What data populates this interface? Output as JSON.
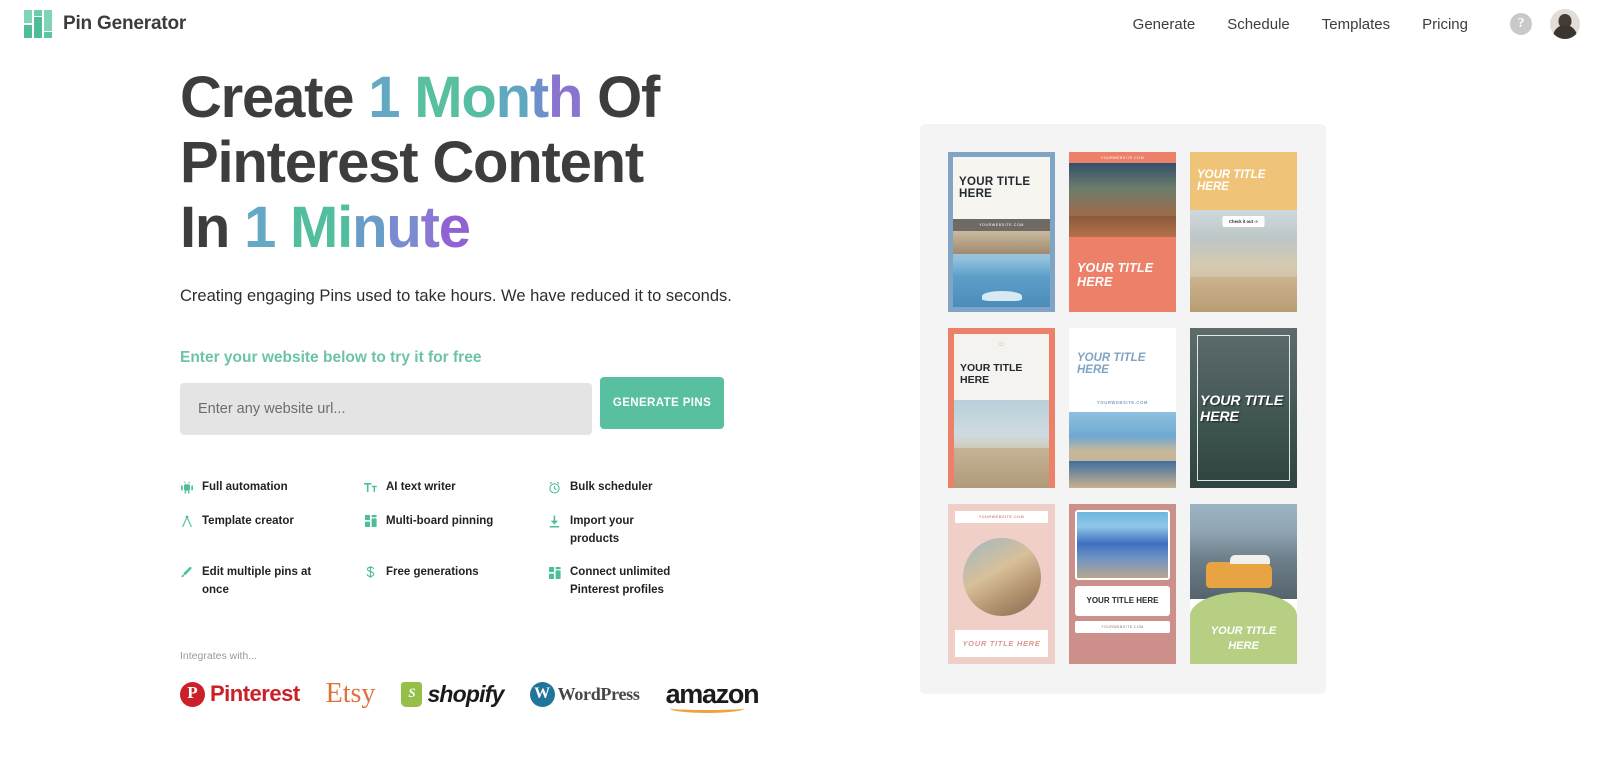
{
  "header": {
    "brand_name": "Pin Generator",
    "logo_icon": "grid-logo-icon",
    "nav": [
      {
        "label": "Generate"
      },
      {
        "label": "Schedule"
      },
      {
        "label": "Templates"
      },
      {
        "label": "Pricing"
      }
    ],
    "help_icon": "question-mark-icon",
    "help_glyph": "?",
    "avatar_icon": "user-avatar"
  },
  "hero": {
    "headline_segments": [
      {
        "text": "Create ",
        "color": "#3d3d3d"
      },
      {
        "text": "1",
        "color": "#64a9c4"
      },
      {
        "text": " ",
        "color": "#3d3d3d"
      },
      {
        "text": "M",
        "color": "#58bfa0"
      },
      {
        "text": "o",
        "color": "#56bda4"
      },
      {
        "text": "n",
        "color": "#5fa8c0"
      },
      {
        "text": "t",
        "color": "#6f8fcc"
      },
      {
        "text": "h",
        "color": "#8a74cf"
      },
      {
        "text": " Of Pinterest Content In ",
        "color": "#3d3d3d"
      },
      {
        "text": "1",
        "color": "#64a9c4"
      },
      {
        "text": " ",
        "color": "#3d3d3d"
      },
      {
        "text": "M",
        "color": "#52bd9f"
      },
      {
        "text": "i",
        "color": "#52bd9f"
      },
      {
        "text": "n",
        "color": "#6a9cc8"
      },
      {
        "text": "u",
        "color": "#7b8bd0"
      },
      {
        "text": "t",
        "color": "#8b78d2"
      },
      {
        "text": "e",
        "color": "#9063d4"
      }
    ],
    "subtitle": "Creating engaging Pins used to take hours. We have reduced it to seconds.",
    "cta_label": "Enter your website below to try it for free"
  },
  "form": {
    "input_placeholder": "Enter any website url...",
    "input_value": "",
    "button_label": "GENERATE PINS",
    "button_color": "#58bfa0"
  },
  "features": [
    {
      "icon": "robot-icon",
      "label": "Full automation"
    },
    {
      "icon": "text-format-icon",
      "label": "AI text writer"
    },
    {
      "icon": "alarm-clock-icon",
      "label": "Bulk scheduler"
    },
    {
      "icon": "compass-icon",
      "label": "Template creator"
    },
    {
      "icon": "grid-boards-icon",
      "label": "Multi-board pinning"
    },
    {
      "icon": "download-icon",
      "label": "Import your products"
    },
    {
      "icon": "brush-icon",
      "label": "Edit multiple pins at once"
    },
    {
      "icon": "dollar-sign-icon",
      "label": "Free generations"
    },
    {
      "icon": "grid-boards-icon",
      "label": "Connect unlimited Pinterest profiles"
    }
  ],
  "integrations": {
    "label": "Integrates with...",
    "logos": [
      {
        "name": "pinterest-logo",
        "text": "Pinterest",
        "glyph": "P",
        "color": "#cb2027"
      },
      {
        "name": "etsy-logo",
        "text": "Etsy",
        "color": "#e2703a"
      },
      {
        "name": "shopify-logo",
        "text": "shopify",
        "glyph": "S",
        "color": "#95bf47"
      },
      {
        "name": "wordpress-logo",
        "text": "WordPress",
        "glyph": "W",
        "color": "#21759b"
      },
      {
        "name": "amazon-logo",
        "text": "amazon",
        "color": "#1c1c1c"
      }
    ]
  },
  "pin_preview": {
    "pins": [
      {
        "title": "YOUR TITLE HERE",
        "website": "YOURWEBSITE.COM",
        "accent": "#7fa4c4"
      },
      {
        "title": "YOUR TITLE HERE",
        "website": "YOURWEBSITE.COM",
        "accent": "#ec8069"
      },
      {
        "title": "YOUR TITLE HERE",
        "badge": "Check it out ->",
        "accent": "#f0c478"
      },
      {
        "title": "YOUR TITLE HERE",
        "accent": "#ec8069"
      },
      {
        "title": "YOUR TITLE HERE",
        "website": "YOURWEBSITE.COM",
        "accent": "#7fa4c4"
      },
      {
        "title": "YOUR TITLE HERE",
        "accent": "#3d4b4a"
      },
      {
        "title": "YOUR TITLE HERE",
        "website": "YOURWEBSITE.COM",
        "accent": "#f0cfc9"
      },
      {
        "title": "YOUR TITLE HERE",
        "website": "YOURWEBSITE.COM",
        "accent": "#cc8f8a"
      },
      {
        "title": "YOUR TITLE HERE",
        "accent": "#b7cf83"
      }
    ]
  }
}
